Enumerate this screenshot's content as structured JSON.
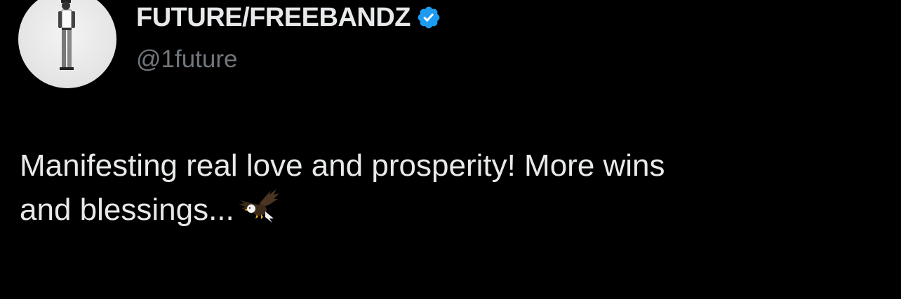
{
  "tweet": {
    "author": {
      "display_name": "FUTURE/FREEBANDZ",
      "handle": "@1future",
      "verified": true,
      "avatar_icon": "person-standing-avatar"
    },
    "text_line1": "Manifesting real love and prosperity! More wins",
    "text_line2": "and blessings...",
    "emoji": "eagle-icon"
  },
  "colors": {
    "background": "#000000",
    "primary_text": "#e7e9ea",
    "secondary_text": "#71767b",
    "verified_badge": "#1d9bf0"
  }
}
